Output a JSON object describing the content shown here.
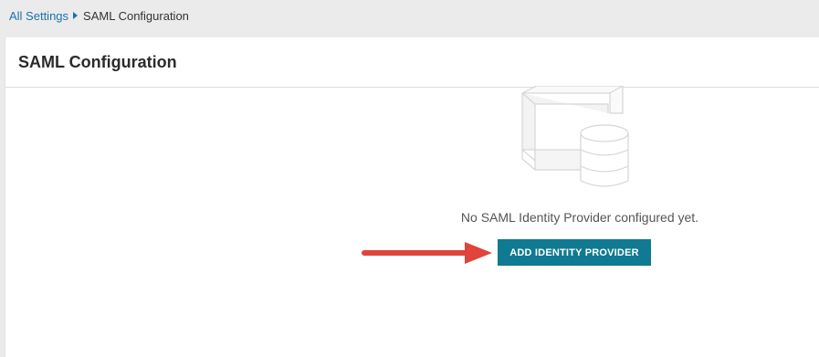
{
  "breadcrumb": {
    "parent_label": "All Settings",
    "current_label": "SAML Configuration"
  },
  "page": {
    "title": "SAML Configuration"
  },
  "empty_state": {
    "message": "No SAML Identity Provider configured yet.",
    "illustration": "box-and-database-icon",
    "button_label": "ADD IDENTITY PROVIDER"
  },
  "annotation": {
    "arrow_color": "#e0443b"
  },
  "colors": {
    "link": "#1a73a8",
    "button": "#0f7a91",
    "background": "#ebebeb"
  }
}
